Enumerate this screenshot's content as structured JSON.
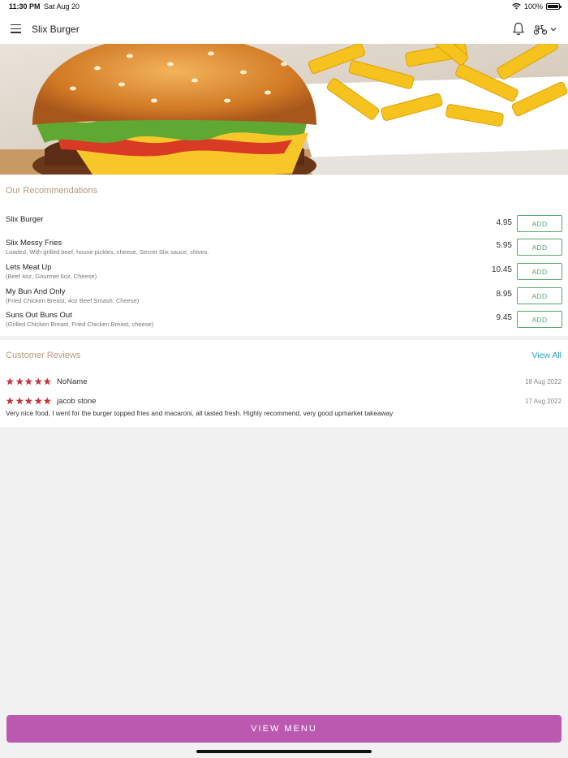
{
  "status_bar": {
    "time": "11:30 PM",
    "date": "Sat Aug 20",
    "battery": "100%"
  },
  "header": {
    "title": "Slix Burger",
    "icons": [
      "menu-icon",
      "bell-icon",
      "delivery-scooter-icon",
      "chevron-down-icon"
    ]
  },
  "hero": {
    "icons": [
      "burger-photo",
      "fries-photo"
    ]
  },
  "recommendations": {
    "title": "Our Recommendations",
    "add_label": "ADD",
    "items": [
      {
        "name": "Slix Burger",
        "description": "",
        "price": "4.95"
      },
      {
        "name": "Slix Messy Fries",
        "description": "Loaded, With grilled beef, house pickles, cheese, Secret Slix sauce, chives.",
        "price": "5.95"
      },
      {
        "name": "Lets Meat Up",
        "description": "(Beef 4oz, Gourmet 6oz, Cheese)",
        "price": "10.45"
      },
      {
        "name": "My Bun And Only",
        "description": "(Fried Chicken Breast, 4oz Beef Smash, Cheese)",
        "price": "8.95"
      },
      {
        "name": "Suns Out Buns Out",
        "description": "(Grilled Chicken Breast, Fried Chicken Breast, cheese)",
        "price": "9.45"
      }
    ]
  },
  "reviews": {
    "title": "Customer Reviews",
    "view_all": "View All",
    "star_color": "#c8313a",
    "items": [
      {
        "author": "NoName",
        "date": "18 Aug 2022",
        "rating": 5,
        "text": ""
      },
      {
        "author": "jacob stone",
        "date": "17 Aug 2022",
        "rating": 5,
        "text": "Very nice food, I went for the burger topped fries and macaroni, all tasted fresh. Highly recommend, very good upmarket takeaway"
      }
    ]
  },
  "footer": {
    "button_label": "VIEW MENU",
    "button_color": "#bb59b0"
  }
}
